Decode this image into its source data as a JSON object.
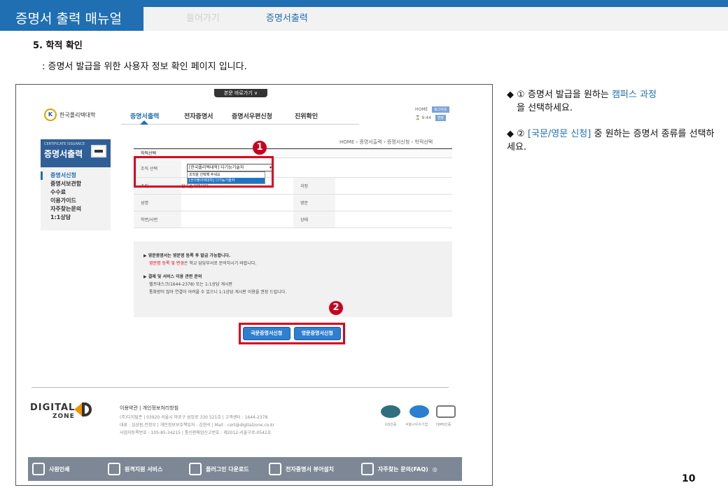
{
  "manual": {
    "title": "증명서 출력 매뉴얼",
    "tabs": [
      "들어가기",
      "증명서출력"
    ]
  },
  "section": {
    "title": "5. 학적 확인",
    "description": ": 증명서 발급을 위한 사용자 정보 확인 페이지 입니다."
  },
  "screen": {
    "top_pill": "본문 바로가기 ∨",
    "logo_text": "한국폴리텍대학",
    "gnav": [
      "증명서출력",
      "전자증명서",
      "증명서우편신청",
      "진위확인"
    ],
    "util_home": "HOME",
    "util_time": "9:44",
    "util_btn1": "로그아웃",
    "util_btn2": "연장",
    "lnb_sub": "CERTIFICATE ISSUANCE",
    "lnb_title": "증명서출력",
    "lnb_items": [
      "증명서신청",
      "증명서보관함",
      "수수료",
      "이용가이드",
      "자주찾는문의",
      "1:1상담"
    ],
    "breadcrumb": "HOME  ›  증명서출력  ›  증명서신청  ›  학적선택",
    "box_title": "학적선택",
    "row_labels": {
      "org_select": "조직 선택",
      "org": "조직",
      "course": "과정",
      "name": "성명",
      "eng_name": "영문",
      "student_id": "학번/사번",
      "status": "상태"
    },
    "select_value": "[한국폴리텍대학] 다기능기술자",
    "dropdown_options": [
      "조직을 선택해 주세요",
      "[한국폴리텍대학] 다기능기술자"
    ],
    "org_value": "한국폴리텍대학",
    "notice": {
      "line1": "▶ 영문증명서는 영문명 등록 후 발급 가능합니다.",
      "line2_red": "영문명 등록 및 변경",
      "line2_rest": "은 학교 담당부서로 문의하시기 바랍니다.",
      "line3": "▶ 결제 및 서비스 이용 관련 문의",
      "line4": "헬프데스크(1644-2378) 또는 1:1상담 게시판",
      "line5": "통화량이 많아 연결이 어려울 수 있으니 1:1상담 게시판 이용을 권장 드립니다."
    },
    "buttons": {
      "korean": "국문증명서신청",
      "english": "영문증명서신청"
    },
    "markers": [
      "1",
      "2"
    ],
    "footer": {
      "logo_top": "DIGITAL",
      "logo_bottom": "ZONE",
      "links": "이용약관 | 개인정보처리방침",
      "info1": "(주)디지털존 | 03920 서울시 마포구 성암로 330 521호 | 고객센터 : 1644-2378",
      "info2": "대표 : 심상원,전정우 | 개인정보보호책임자 : 김현석 | Mail : cert@digitalzone.co.kr",
      "info3": "사업자등록번호 : 105-85-34215 | 통신판매업신고번호 : 제2012-서울구로-0542호",
      "cert_labels": [
        "GS인증",
        "서울시우수기업",
        "ISMS인증"
      ]
    },
    "bottom_bar": [
      "사원인쇄",
      "원격지원 서비스",
      "플러그인 다운로드",
      "전자증명서 뷰어설치",
      "자주찾는 문의(FAQ)"
    ]
  },
  "notes": {
    "note1_prefix": "◆ ① 증명서 발급을 원하는 ",
    "note1_blue": "캠퍼스 과정",
    "note1_suffix": "을 선택하세요.",
    "note2_prefix": "◆ ② ",
    "note2_blue": "[국문/영문 신청]",
    "note2_suffix": " 중 원하는 증명서 종류를 선택하세요."
  },
  "page_number": "10",
  "colors": {
    "brand_blue": "#1f6fb2",
    "highlight_red": "#d8001f",
    "button_blue": "#2f7fd0"
  }
}
